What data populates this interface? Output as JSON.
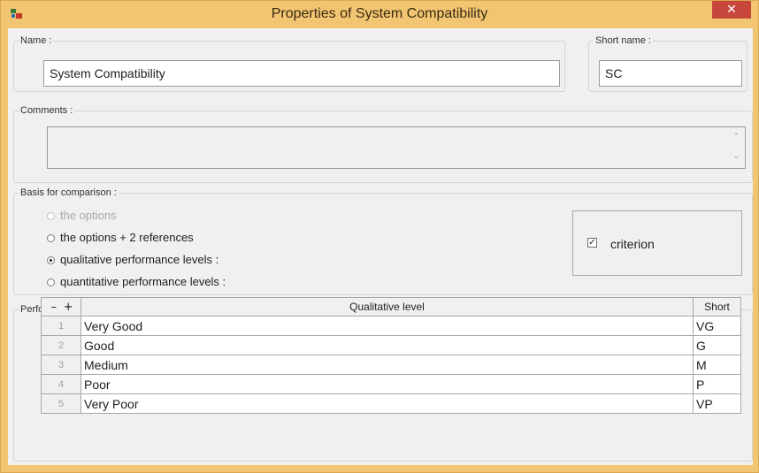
{
  "window": {
    "title": "Properties of  System Compatibility",
    "close_glyph": "✕",
    "app_icon": "app-icon"
  },
  "name_group": {
    "legend": "Name :",
    "value": "System Compatibility"
  },
  "short_name_group": {
    "legend": "Short name :",
    "value": "SC"
  },
  "comments_group": {
    "legend": "Comments :",
    "value": "",
    "scroll_up": "⌃",
    "scroll_down": "⌄"
  },
  "basis_group": {
    "legend": "Basis for comparison :",
    "options": [
      {
        "label": "the options",
        "checked": false,
        "enabled": false
      },
      {
        "label": "the options + 2 references",
        "checked": false,
        "enabled": true
      },
      {
        "label": "qualitative performance levels :",
        "checked": true,
        "enabled": true
      },
      {
        "label": "quantitative performance levels :",
        "checked": false,
        "enabled": true
      }
    ],
    "criterion": {
      "label": "criterion",
      "checked": true,
      "check_glyph": "✓"
    }
  },
  "levels_group": {
    "legend": "Performance levels :",
    "minus": "–",
    "plus": "+",
    "col_level": "Qualitative level",
    "col_short": "Short",
    "rows": [
      {
        "idx": "1",
        "level": "Very Good",
        "short": "VG"
      },
      {
        "idx": "2",
        "level": "Good",
        "short": "G"
      },
      {
        "idx": "3",
        "level": "Medium",
        "short": "M"
      },
      {
        "idx": "4",
        "level": "Poor",
        "short": "P"
      },
      {
        "idx": "5",
        "level": "Very Poor",
        "short": "VP"
      }
    ]
  },
  "colors": {
    "titlebar": "#f2c572",
    "close": "#c7473d",
    "dialog_bg": "#f0f0f0"
  }
}
